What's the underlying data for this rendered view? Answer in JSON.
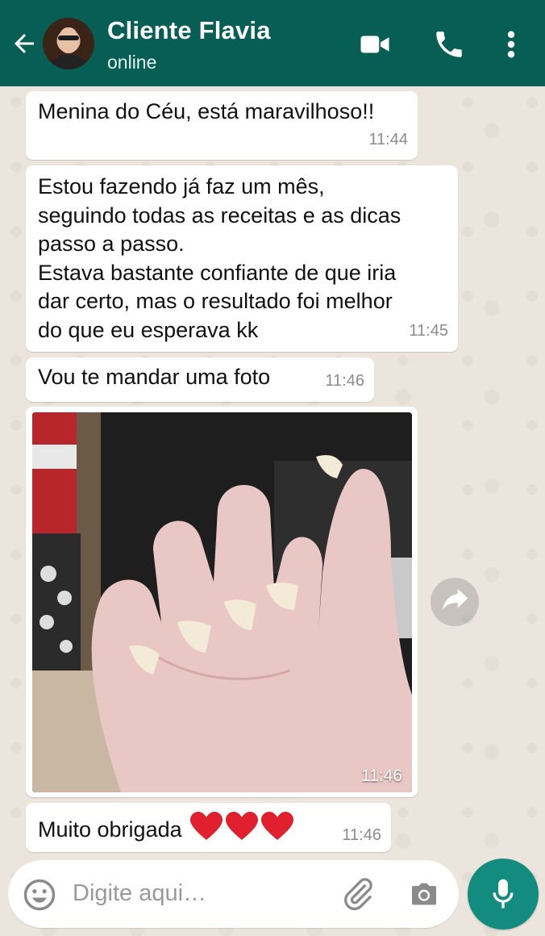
{
  "header": {
    "contact_name": "Cliente Flavia",
    "status": "online",
    "background_color": "#075e54"
  },
  "messages": [
    {
      "text": "Menina do Céu, está maravilhoso!!",
      "time": "11:44"
    },
    {
      "text": "Estou fazendo já faz um mês,\nseguindo todas as receitas e as dicas\npasso a passo.\nEstava bastante confiante de que iria\ndar certo, mas o resultado foi melhor\ndo que eu esperava kk",
      "time": "11:45"
    },
    {
      "text": "Vou te mandar uma foto",
      "time": "11:46"
    },
    {
      "type": "image",
      "time": "11:46"
    },
    {
      "text": "Muito obrigada",
      "time": "11:46",
      "emoji": "red-heart x3"
    }
  ],
  "composer": {
    "placeholder": "Digite aqui…"
  },
  "colors": {
    "accent": "#128c7e",
    "bubble": "#ffffff",
    "wallpaper": "#ece5dd"
  },
  "icons": [
    "back-arrow-icon",
    "video-call-icon",
    "phone-icon",
    "more-options-icon",
    "forward-icon",
    "emoji-icon",
    "attach-icon",
    "camera-icon",
    "mic-icon"
  ]
}
